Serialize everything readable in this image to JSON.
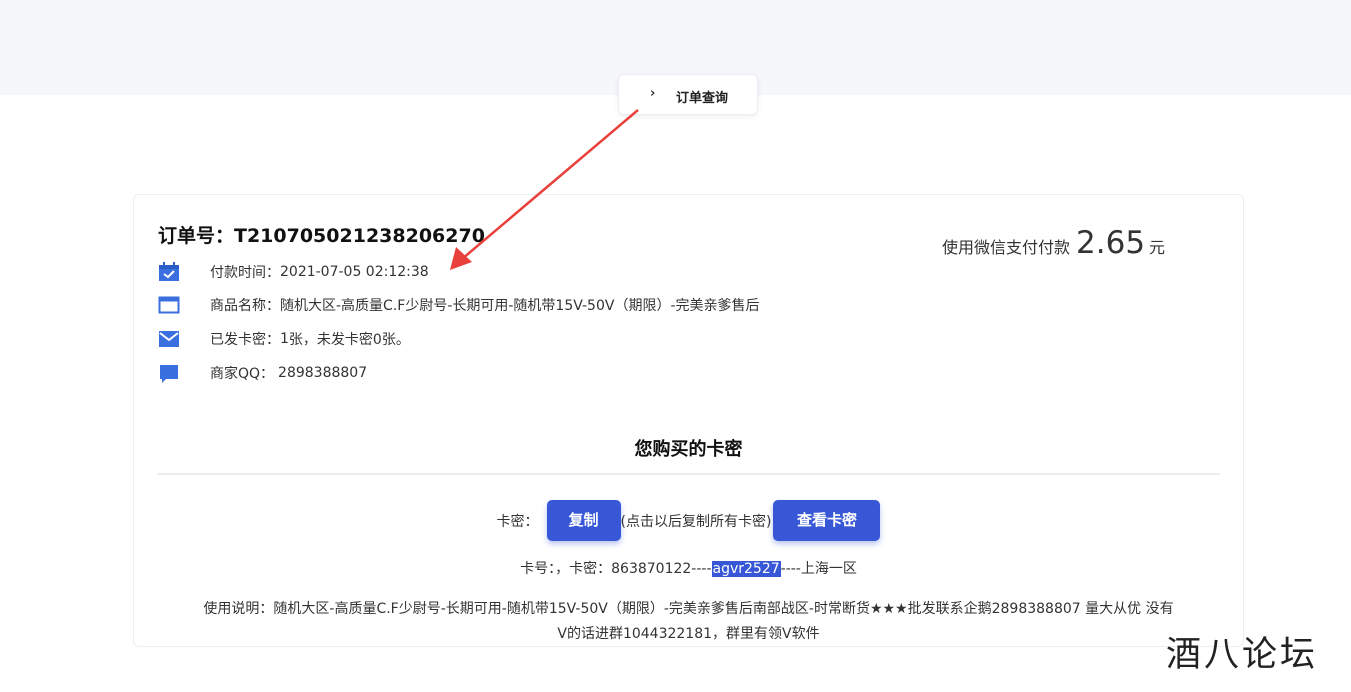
{
  "nav": {
    "order_query_label": "订单查询"
  },
  "order": {
    "number_line": "订单号：T210705021238206270",
    "pay_label": "使用微信支付付款",
    "amount": "2.65",
    "unit": "元",
    "info": {
      "pay_time_label": "付款时间：",
      "pay_time": "2021-07-05 02:12:38",
      "product_label": "商品名称：",
      "product": "随机大区-高质量C.F少尉号-长期可用-随机带15V-50V（期限）-完美亲爹售后",
      "sent_label": "已发卡密：",
      "sent_count": "1",
      "sent_suffix": "张，未发卡密0张。",
      "merchant_label": "商家QQ：",
      "merchant_qq": "2898388807"
    }
  },
  "cards": {
    "section_title": "您购买的卡密",
    "km_label": "卡密：",
    "copy_button": "复制",
    "copy_hint": "(点击以后复制所有卡密)",
    "view_button": "查看卡密",
    "line_prefix": "卡号：，卡密：863870122----",
    "line_highlight": "agvr2527",
    "line_suffix": "----上海一区",
    "usage_line1": "使用说明：随机大区-高质量C.F少尉号-长期可用-随机带15V-50V（期限）-完美亲爹售后南部战区-时常断货★★★批发联系企鹅2898388807 量大从优 没有",
    "usage_line2": "V的话进群1044322181，群里有领V软件"
  },
  "watermark": "酒八论坛",
  "colors": {
    "accent": "#3757d6",
    "link": "#4a8cf0",
    "arrow": "#e8413c"
  },
  "icons": [
    "calendar-check-icon",
    "window-icon",
    "envelope-icon",
    "chat-icon",
    "chevron-right-icon"
  ]
}
